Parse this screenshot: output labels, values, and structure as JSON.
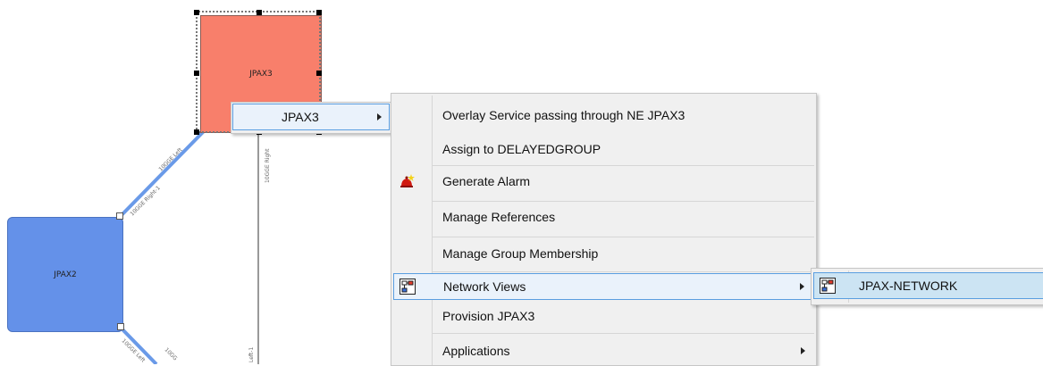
{
  "nodes": {
    "jpax3": {
      "label": "JPAX3",
      "color": "#f87f6b"
    },
    "jpax2": {
      "label": "JPAX2",
      "color": "#6491e9"
    }
  },
  "links": {
    "top_left_label": "10GGE Left",
    "top_right_label": "10GGE Right-1",
    "upper_vertical_label": "10GGE Right",
    "lower_label_a": "10GGE Left",
    "lower_label_b": "10GG",
    "lower_vertical_label": "Left-1"
  },
  "context_menu": {
    "root_item": "JPAX3",
    "items": [
      {
        "label": "Overlay Service passing through NE JPAX3"
      },
      {
        "label": "Assign to DELAYEDGROUP"
      },
      {
        "label": "Generate Alarm",
        "icon": "alarm-bell-icon"
      },
      {
        "label": "Manage References"
      },
      {
        "label": "Manage Group Membership"
      },
      {
        "label": "Network Views",
        "icon": "network-view-icon",
        "has_submenu": true
      },
      {
        "label": "Provision JPAX3"
      },
      {
        "label": "Applications",
        "has_submenu": true
      }
    ],
    "network_views_submenu": [
      {
        "label": "JPAX-NETWORK",
        "icon": "network-view-icon"
      }
    ]
  },
  "colors": {
    "highlight_border": "#5a9ee0",
    "highlight_fill": "#eaf2fb",
    "link_blue": "#6a9ae8"
  }
}
